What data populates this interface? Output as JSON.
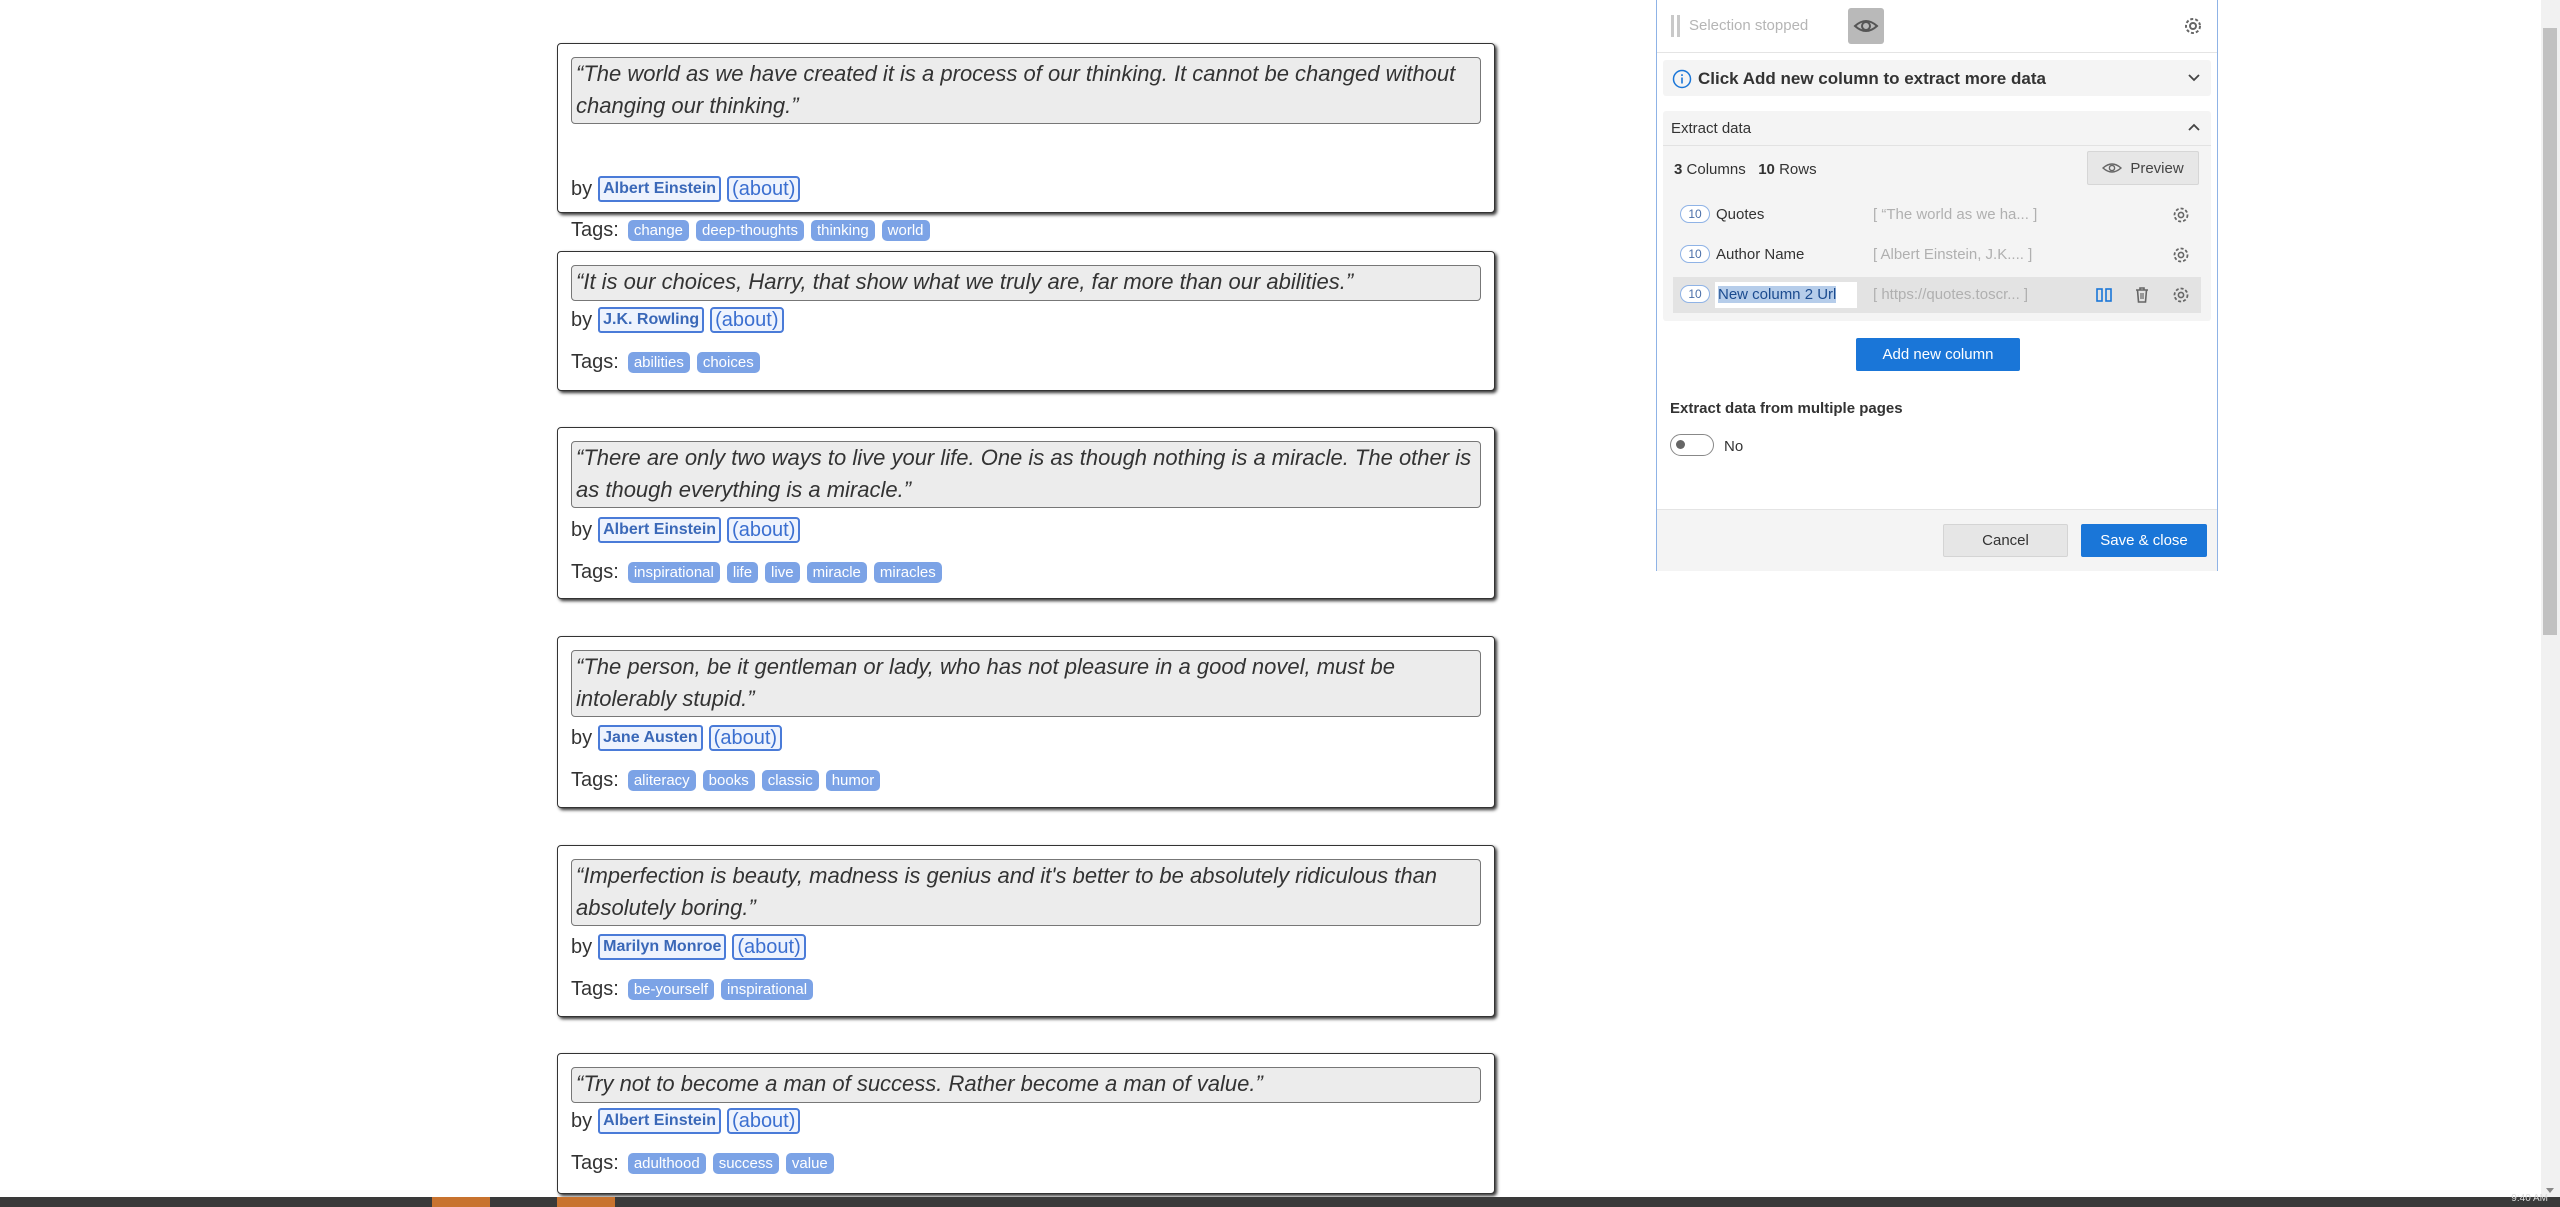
{
  "quotes": [
    {
      "text": "“The world as we have created it is a process of our thinking. It cannot be changed without changing our thinking.”",
      "author": "Albert Einstein",
      "about": "(about)",
      "tags_label": "Tags:",
      "tags": [
        "change",
        "deep-thoughts",
        "thinking",
        "world"
      ]
    },
    {
      "text": "“It is our choices, Harry, that show what we truly are, far more than our abilities.”",
      "author": "J.K. Rowling",
      "about": "(about)",
      "tags_label": "Tags:",
      "tags": [
        "abilities",
        "choices"
      ]
    },
    {
      "text": "“There are only two ways to live your life. One is as though nothing is a miracle. The other is as though everything is a miracle.”",
      "author": "Albert Einstein",
      "about": "(about)",
      "tags_label": "Tags:",
      "tags": [
        "inspirational",
        "life",
        "live",
        "miracle",
        "miracles"
      ]
    },
    {
      "text": "“The person, be it gentleman or lady, who has not pleasure in a good novel, must be intolerably stupid.”",
      "author": "Jane Austen",
      "about": "(about)",
      "tags_label": "Tags:",
      "tags": [
        "aliteracy",
        "books",
        "classic",
        "humor"
      ]
    },
    {
      "text": "“Imperfection is beauty, madness is genius and it's better to be absolutely ridiculous than absolutely boring.”",
      "author": "Marilyn Monroe",
      "about": "(about)",
      "tags_label": "Tags:",
      "tags": [
        "be-yourself",
        "inspirational"
      ]
    },
    {
      "text": "“Try not to become a man of success. Rather become a man of value.”",
      "author": "Albert Einstein",
      "about": "(about)",
      "tags_label": "Tags:",
      "tags": [
        "adulthood",
        "success",
        "value"
      ]
    }
  ],
  "by_label": "by",
  "panel": {
    "status": "Selection stopped",
    "hint": "Click Add new column to extract more data",
    "section_title": "Extract data",
    "columns_count": "3",
    "columns_label": "Columns",
    "rows_count": "10",
    "rows_label": "Rows",
    "preview_label": "Preview",
    "columns": [
      {
        "count": "10",
        "name": "Quotes",
        "preview": "[ “The world as we ha... ]"
      },
      {
        "count": "10",
        "name": "Author Name",
        "preview": "[ Albert Einstein, J.K.... ]"
      },
      {
        "count": "10",
        "name": "New column 2 Url",
        "preview": "[ https://quotes.toscr... ]"
      }
    ],
    "add_column_label": "Add new column",
    "multi_page_title": "Extract data from multiple pages",
    "multi_page_value": "No",
    "cancel_label": "Cancel",
    "save_label": "Save & close"
  },
  "colors": {
    "accent": "#1a76d8",
    "tag": "#7ca3e6",
    "link_border": "#4a7bd8"
  },
  "taskbar": {
    "clock": "9:40 AM"
  }
}
